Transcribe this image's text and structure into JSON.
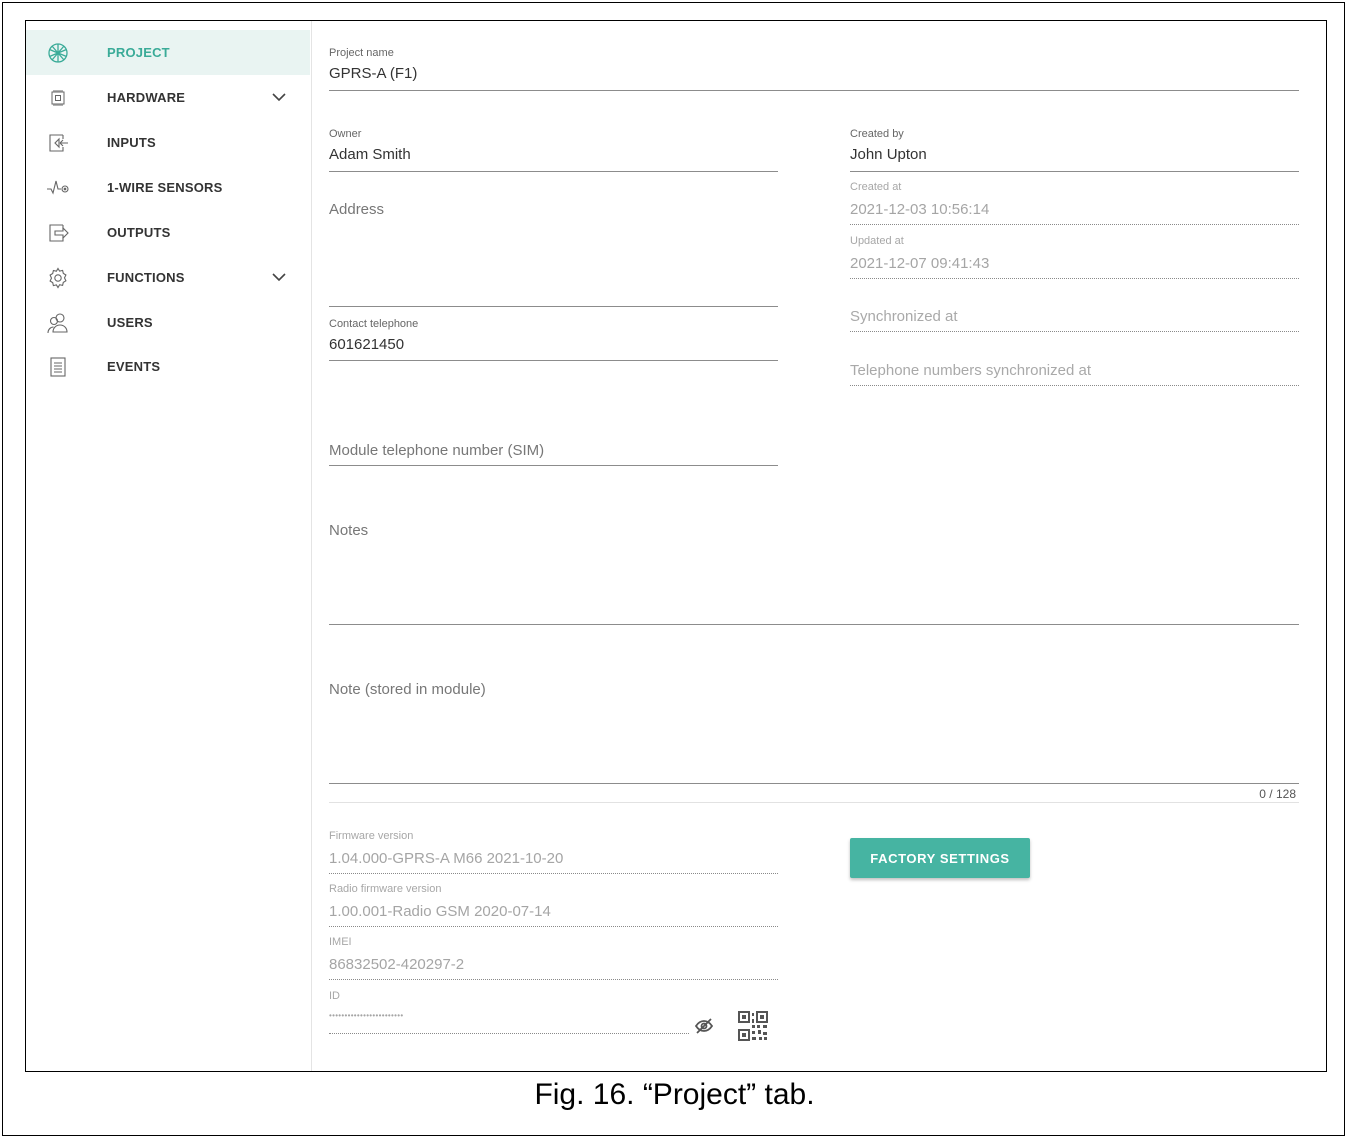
{
  "sidebar": {
    "items": [
      {
        "label": "PROJECT",
        "icon": "project-icon",
        "active": true
      },
      {
        "label": "HARDWARE",
        "icon": "hardware-chip-icon",
        "expandable": true
      },
      {
        "label": "INPUTS",
        "icon": "inputs-icon"
      },
      {
        "label": "1-WIRE SENSORS",
        "icon": "sensor-icon"
      },
      {
        "label": "OUTPUTS",
        "icon": "outputs-icon"
      },
      {
        "label": "FUNCTIONS",
        "icon": "gear-icon",
        "expandable": true
      },
      {
        "label": "USERS",
        "icon": "users-icon"
      },
      {
        "label": "EVENTS",
        "icon": "events-list-icon"
      }
    ]
  },
  "form": {
    "project_name": {
      "label": "Project name",
      "value": "GPRS-A (F1)"
    },
    "owner": {
      "label": "Owner",
      "value": "Adam Smith"
    },
    "created_by": {
      "label": "Created by",
      "value": "John Upton"
    },
    "address": {
      "placeholder": "Address"
    },
    "created_at": {
      "label": "Created at",
      "value": "2021-12-03 10:56:14"
    },
    "updated_at": {
      "label": "Updated at",
      "value": "2021-12-07 09:41:43"
    },
    "synchronized_at": {
      "placeholder": "Synchronized at"
    },
    "telephone_synchronized_at": {
      "placeholder": "Telephone numbers synchronized at"
    },
    "contact_telephone": {
      "label": "Contact telephone",
      "value": "601621450"
    },
    "module_telephone": {
      "placeholder": "Module telephone number (SIM)"
    },
    "notes": {
      "placeholder": "Notes"
    },
    "note_module": {
      "placeholder": "Note (stored in module)",
      "counter": "0 / 128"
    }
  },
  "info": {
    "firmware": {
      "label": "Firmware version",
      "value": "1.04.000-GPRS-A M66 2021-10-20"
    },
    "radio_firmware": {
      "label": "Radio firmware version",
      "value": "1.00.001-Radio GSM 2020-07-14"
    },
    "imei": {
      "label": "IMEI",
      "value": "86832502-420297-2"
    },
    "id": {
      "label": "ID",
      "value": "••••••••••••••••••••••••"
    }
  },
  "actions": {
    "factory_settings": "FACTORY SETTINGS"
  },
  "caption": "Fig. 16. “Project” tab.",
  "colors": {
    "accent": "#46b4a2",
    "active_bg": "#e9f4f2"
  }
}
